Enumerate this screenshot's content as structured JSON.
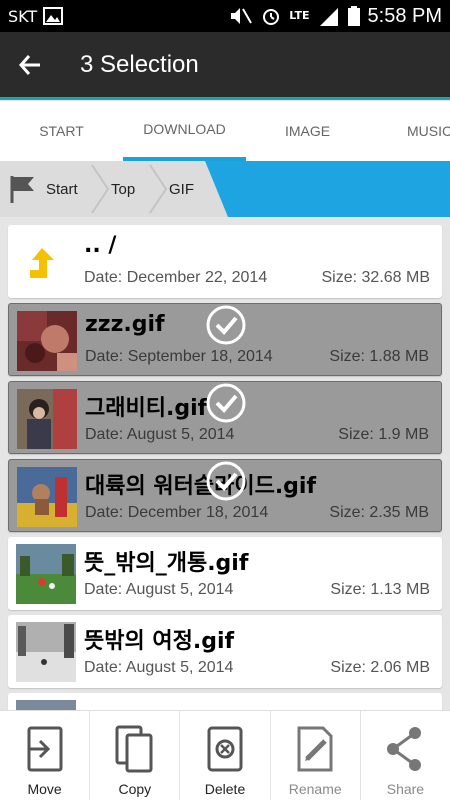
{
  "status": {
    "carrier": "SKT",
    "network": "LTE",
    "time": "5:58 PM"
  },
  "header": {
    "title": "3 Selection"
  },
  "tabs": [
    {
      "label": "START",
      "active": false
    },
    {
      "label": "DOWNLOAD",
      "active": true
    },
    {
      "label": "IMAGE",
      "active": false
    },
    {
      "label": "MUSIC",
      "active": false
    }
  ],
  "breadcrumb": [
    {
      "label": "Start"
    },
    {
      "label": "Top"
    },
    {
      "label": "GIF"
    }
  ],
  "files": [
    {
      "name": ".. /",
      "date": "Date: December 22, 2014",
      "size": "Size: 32.68 MB",
      "selected": false,
      "thumb": "folder-up-icon"
    },
    {
      "name": "zzz.gif",
      "date": "Date: September 18, 2014",
      "size": "Size: 1.88 MB",
      "selected": true,
      "thumb": "image-thumbnail"
    },
    {
      "name": "그래비티.gif",
      "date": "Date: August 5, 2014",
      "size": "Size: 1.9 MB",
      "selected": true,
      "thumb": "image-thumbnail"
    },
    {
      "name": "대륙의 워터슬라이드.gif",
      "date": "Date: December 18, 2014",
      "size": "Size: 2.35 MB",
      "selected": true,
      "thumb": "image-thumbnail"
    },
    {
      "name": "뜻_밖의_개통.gif",
      "date": "Date: August 5, 2014",
      "size": "Size: 1.13 MB",
      "selected": false,
      "thumb": "image-thumbnail"
    },
    {
      "name": "뜻밖의 여정.gif",
      "date": "Date: August 5, 2014",
      "size": "Size: 2.06 MB",
      "selected": false,
      "thumb": "image-thumbnail"
    }
  ],
  "actions": [
    {
      "label": "Move",
      "icon": "move-icon",
      "enabled": true
    },
    {
      "label": "Copy",
      "icon": "copy-icon",
      "enabled": true
    },
    {
      "label": "Delete",
      "icon": "delete-icon",
      "enabled": true
    },
    {
      "label": "Rename",
      "icon": "rename-icon",
      "enabled": false
    },
    {
      "label": "Share",
      "icon": "share-icon",
      "enabled": false
    }
  ],
  "colors": {
    "accent": "#1aa3d8",
    "action_bar": "#2b2b2b",
    "selected_row": "#9a9a9a"
  }
}
